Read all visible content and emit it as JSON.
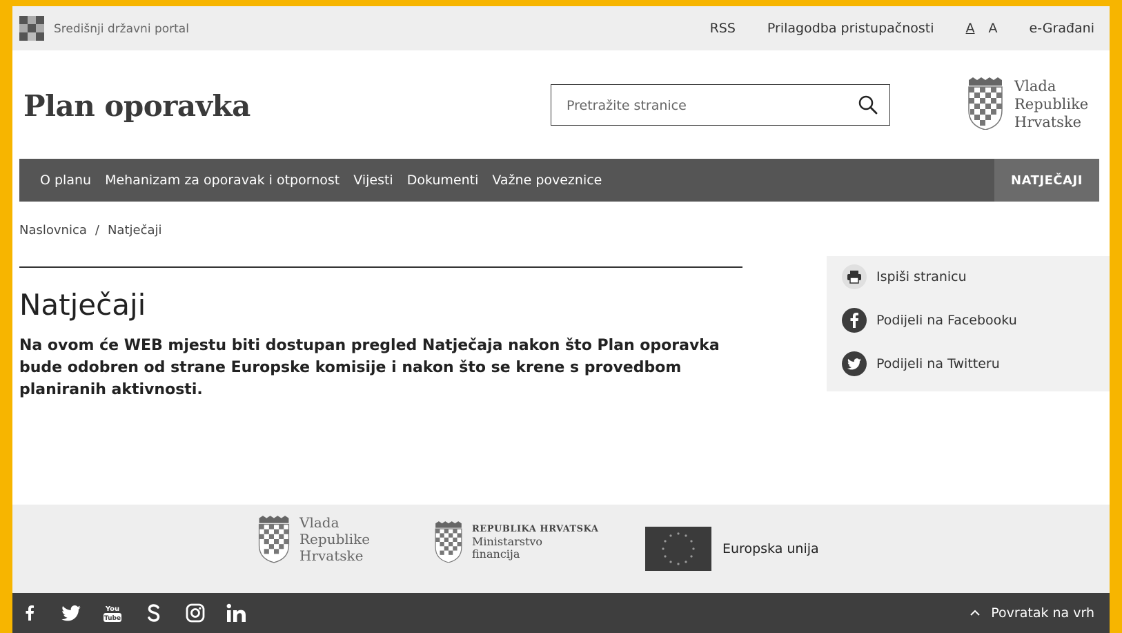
{
  "topbar": {
    "portal_label": "Središnji državni portal",
    "links": {
      "rss": "RSS",
      "accessibility": "Prilagodba pristupačnosti",
      "font_small": "A",
      "font_large": "A",
      "egradjani": "e-Građani"
    }
  },
  "header": {
    "site_title": "Plan oporavka",
    "search_placeholder": "Pretražite stranice",
    "gov_logo": [
      "Vlada",
      "Republike",
      "Hrvatske"
    ]
  },
  "nav": {
    "items": [
      "O planu",
      "Mehanizam za oporavak i otpornost",
      "Vijesti",
      "Dokumenti",
      "Važne poveznice"
    ],
    "cta": "NATJEČAJI"
  },
  "breadcrumb": {
    "home": "Naslovnica",
    "separator": "/",
    "current": "Natječaji"
  },
  "main": {
    "title": "Natječaji",
    "intro": "Na ovom će WEB mjestu biti dostupan pregled Natječaja nakon što Plan oporavka bude odobren od strane Europske komisije i nakon što se krene s provedbom planiranih aktivnosti."
  },
  "share": {
    "print": "Ispiši stranicu",
    "facebook": "Podijeli na Facebooku",
    "twitter": "Podijeli na Twitteru"
  },
  "footer": {
    "logo1": [
      "Vlada",
      "Republike",
      "Hrvatske"
    ],
    "logo2_title": "REPUBLIKA HRVATSKA",
    "logo2_lines": [
      "Ministarstvo",
      "financija"
    ],
    "eu_label": "Europska unija",
    "socials": [
      "facebook-icon",
      "twitter-icon",
      "youtube-icon",
      "s-icon",
      "instagram-icon",
      "linkedin-icon"
    ],
    "youtube_text": [
      "You",
      "Tube"
    ],
    "back_to_top": "Povratak na vrh"
  },
  "colors": {
    "frame": "#f7b500",
    "nav": "#555555",
    "nav_cta": "#6b6b6b",
    "footer_bar": "#3e3e3e",
    "light_bg": "#eeeeee"
  }
}
